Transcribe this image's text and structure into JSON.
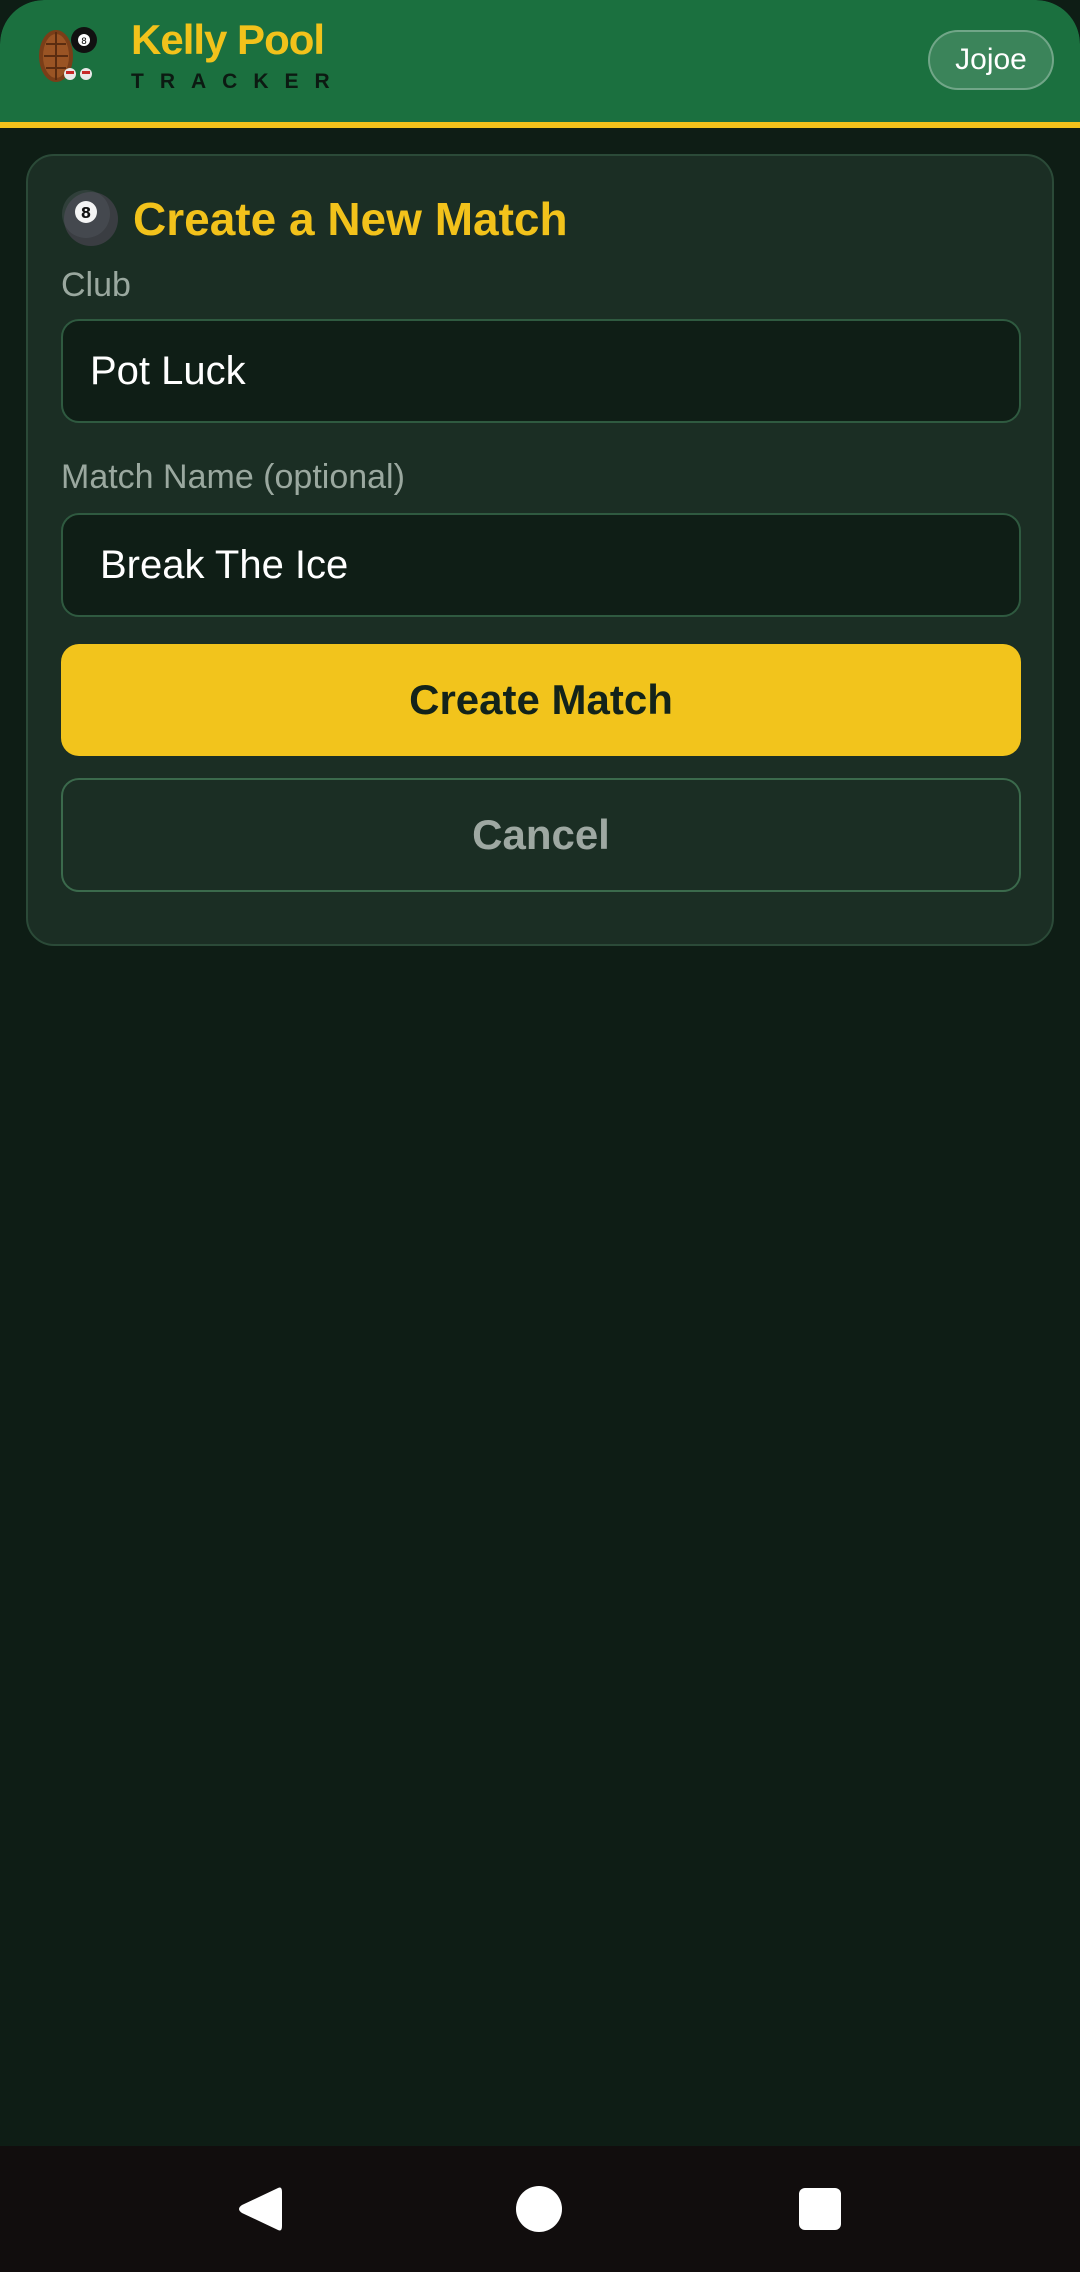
{
  "header": {
    "brand_title": "Kelly Pool",
    "brand_subtitle": "TRACKER",
    "user_label": "Jojoe"
  },
  "card": {
    "title": "Create a New Match",
    "title_icon": "8-ball-icon",
    "club_label": "Club",
    "club_value": "Pot Luck",
    "match_name_label": "Match Name (optional)",
    "match_name_value": "Break The Ice",
    "create_label": "Create Match",
    "cancel_label": "Cancel"
  },
  "colors": {
    "header_green": "#1b703f",
    "accent_yellow": "#f2c21b",
    "background": "#0e1d15",
    "card": "#1b2e24"
  },
  "navbar": {
    "icons": [
      "back-icon",
      "home-icon",
      "recents-icon"
    ]
  }
}
